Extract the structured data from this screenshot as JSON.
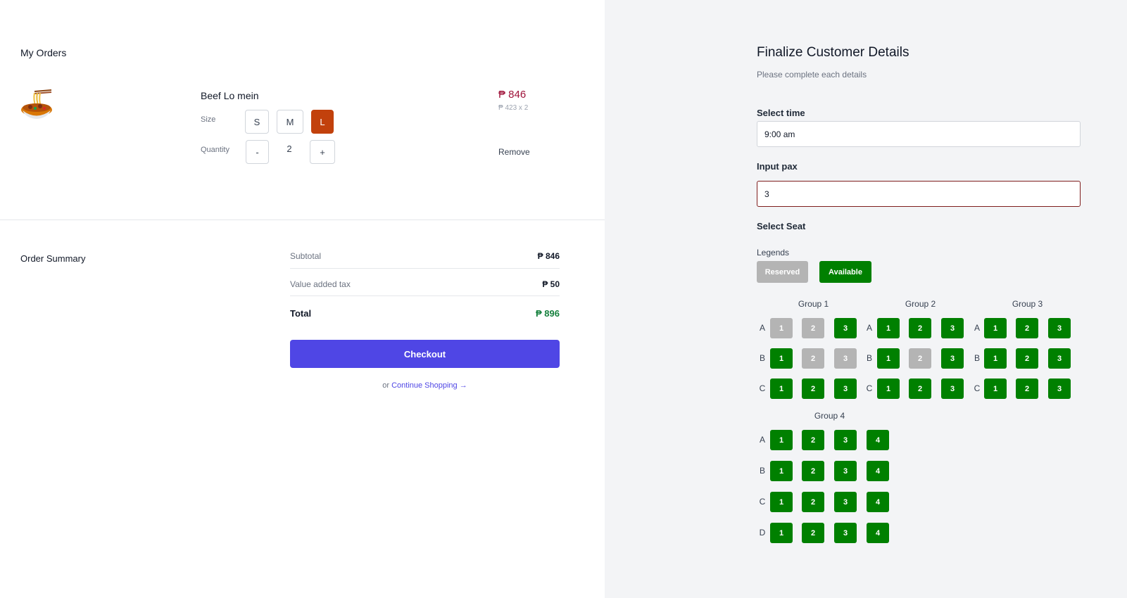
{
  "orders": {
    "title": "My Orders",
    "item": {
      "name": "Beef Lo mein",
      "image_icon": "noodles-bowl-icon",
      "size_label": "Size",
      "sizes": [
        "S",
        "M",
        "L"
      ],
      "selected_size": "L",
      "quantity_label": "Quantity",
      "quantity_minus": "-",
      "quantity_plus": "+",
      "quantity": "2",
      "price": "₱ 846",
      "unit_price": "₱ 423 x 2",
      "remove_label": "Remove"
    }
  },
  "summary": {
    "title": "Order Summary",
    "subtotal_label": "Subtotal",
    "subtotal_value": "₱ 846",
    "vat_label": "Value added tax",
    "vat_value": "₱ 50",
    "total_label": "Total",
    "total_value": "₱ 896",
    "checkout_label": "Checkout",
    "continue_prefix": "or",
    "continue_label": "Continue Shopping →"
  },
  "customer": {
    "title": "Finalize Customer Details",
    "subtitle": "Please complete each details",
    "time_label": "Select time",
    "time_value": "9:00 am",
    "pax_label": "Input pax",
    "pax_value": "3",
    "seat_label": "Select Seat",
    "legends_label": "Legends",
    "legend_reserved": "Reserved",
    "legend_available": "Available"
  },
  "colors": {
    "available": "#008000",
    "reserved": "#b4b4b4",
    "checkout": "#4f46e5",
    "selected_size": "#c2410c",
    "price": "#9f1239",
    "total": "#15803d"
  },
  "seat_groups": [
    {
      "name": "Group 1",
      "rows": [
        {
          "letter": "A",
          "seats": [
            {
              "n": "1",
              "reserved": true
            },
            {
              "n": "2",
              "reserved": true
            },
            {
              "n": "3",
              "reserved": false
            }
          ]
        },
        {
          "letter": "B",
          "seats": [
            {
              "n": "1",
              "reserved": false
            },
            {
              "n": "2",
              "reserved": true
            },
            {
              "n": "3",
              "reserved": true
            }
          ]
        },
        {
          "letter": "C",
          "seats": [
            {
              "n": "1",
              "reserved": false
            },
            {
              "n": "2",
              "reserved": false
            },
            {
              "n": "3",
              "reserved": false
            }
          ]
        }
      ]
    },
    {
      "name": "Group 2",
      "rows": [
        {
          "letter": "A",
          "seats": [
            {
              "n": "1",
              "reserved": false
            },
            {
              "n": "2",
              "reserved": false
            },
            {
              "n": "3",
              "reserved": false
            }
          ]
        },
        {
          "letter": "B",
          "seats": [
            {
              "n": "1",
              "reserved": false
            },
            {
              "n": "2",
              "reserved": true
            },
            {
              "n": "3",
              "reserved": false
            }
          ]
        },
        {
          "letter": "C",
          "seats": [
            {
              "n": "1",
              "reserved": false
            },
            {
              "n": "2",
              "reserved": false
            },
            {
              "n": "3",
              "reserved": false
            }
          ]
        }
      ]
    },
    {
      "name": "Group 3",
      "rows": [
        {
          "letter": "A",
          "seats": [
            {
              "n": "1",
              "reserved": false
            },
            {
              "n": "2",
              "reserved": false
            },
            {
              "n": "3",
              "reserved": false
            }
          ]
        },
        {
          "letter": "B",
          "seats": [
            {
              "n": "1",
              "reserved": false
            },
            {
              "n": "2",
              "reserved": false
            },
            {
              "n": "3",
              "reserved": false
            }
          ]
        },
        {
          "letter": "C",
          "seats": [
            {
              "n": "1",
              "reserved": false
            },
            {
              "n": "2",
              "reserved": false
            },
            {
              "n": "3",
              "reserved": false
            }
          ]
        }
      ]
    },
    {
      "name": "Group 4",
      "rows": [
        {
          "letter": "A",
          "seats": [
            {
              "n": "1",
              "reserved": false
            },
            {
              "n": "2",
              "reserved": false
            },
            {
              "n": "3",
              "reserved": false
            },
            {
              "n": "4",
              "reserved": false
            }
          ]
        },
        {
          "letter": "B",
          "seats": [
            {
              "n": "1",
              "reserved": false
            },
            {
              "n": "2",
              "reserved": false
            },
            {
              "n": "3",
              "reserved": false
            },
            {
              "n": "4",
              "reserved": false
            }
          ]
        },
        {
          "letter": "C",
          "seats": [
            {
              "n": "1",
              "reserved": false
            },
            {
              "n": "2",
              "reserved": false
            },
            {
              "n": "3",
              "reserved": false
            },
            {
              "n": "4",
              "reserved": false
            }
          ]
        },
        {
          "letter": "D",
          "seats": [
            {
              "n": "1",
              "reserved": false
            },
            {
              "n": "2",
              "reserved": false
            },
            {
              "n": "3",
              "reserved": false
            },
            {
              "n": "4",
              "reserved": false
            }
          ]
        }
      ]
    }
  ]
}
